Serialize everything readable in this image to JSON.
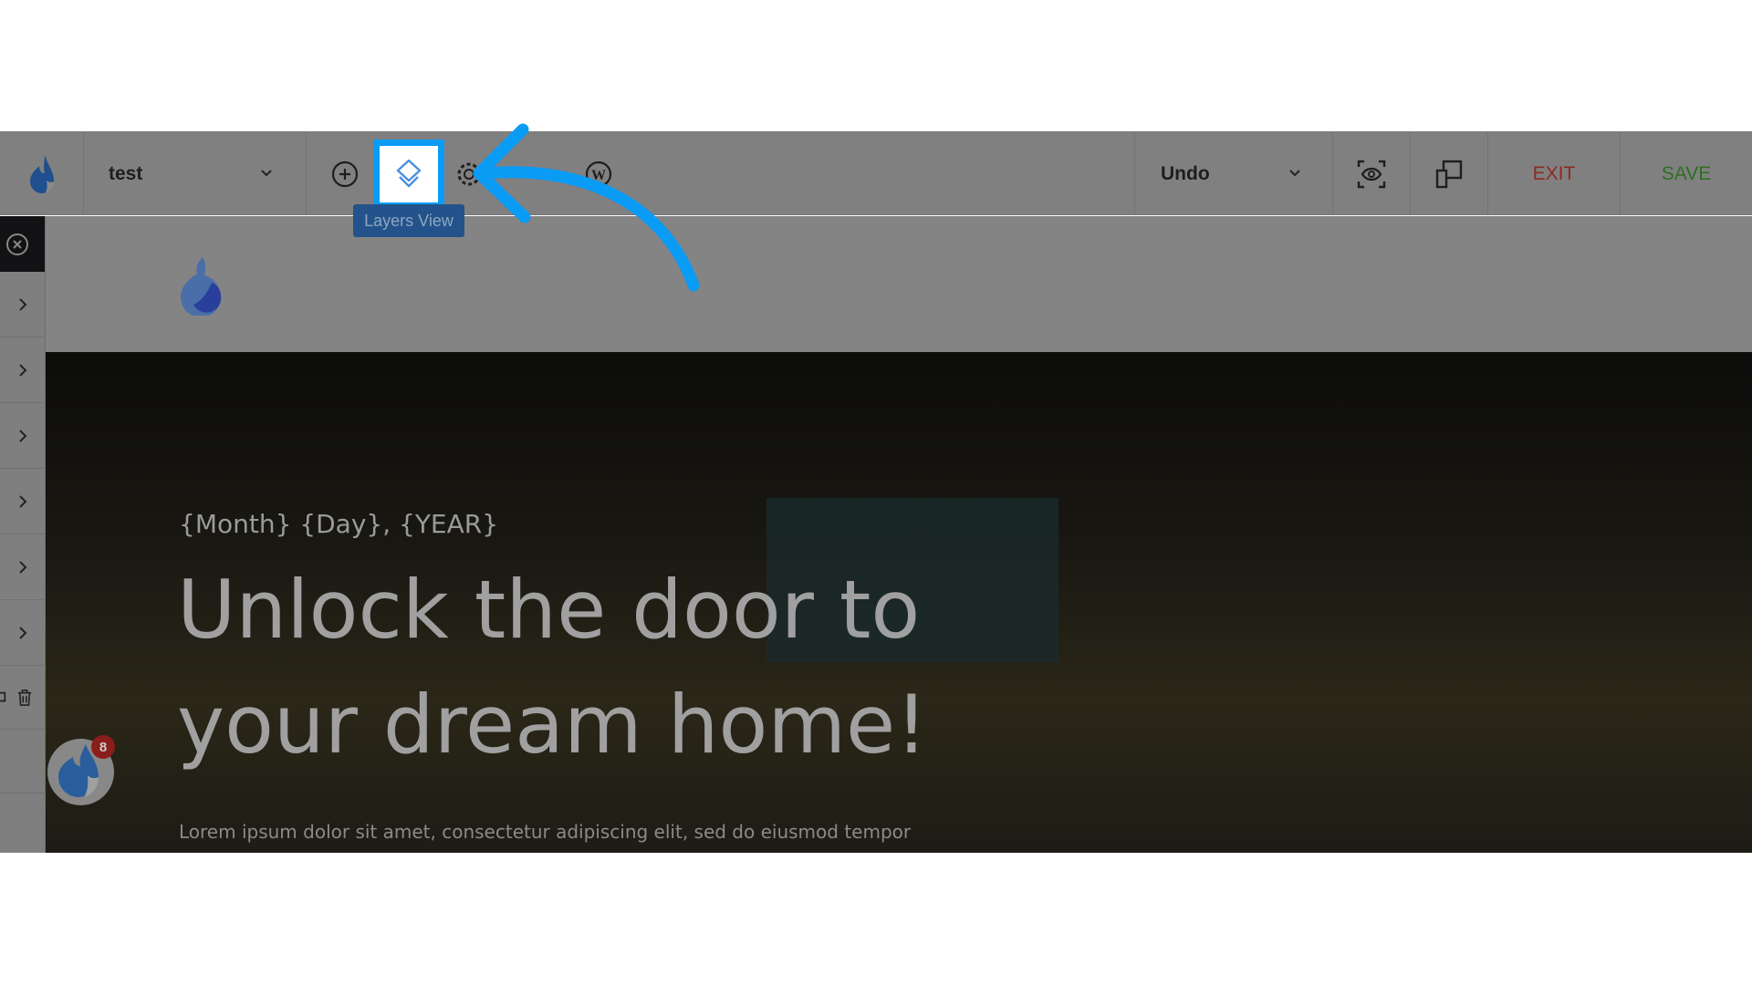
{
  "toolbar": {
    "page_name": "test",
    "undo_label": "Undo",
    "exit_label": "EXIT",
    "save_label": "SAVE",
    "exit_color": "#8b2a22",
    "save_color": "#2f6e22"
  },
  "tooltip": {
    "layers_view": "Layers View"
  },
  "icons": [
    "flame-logo-icon",
    "chevron-down-icon",
    "plus-circle-icon",
    "layers-icon",
    "gear-icon",
    "wordpress-icon",
    "preview-eye-icon",
    "responsive-icon",
    "close-circle-icon",
    "chevron-right-icon",
    "duplicate-icon",
    "trash-icon"
  ],
  "hero": {
    "date": "{Month} {Day}, {YEAR}",
    "headline_line1": "Unlock the door to",
    "headline_line2": "your dream home!",
    "body": "Lorem ipsum dolor sit amet, consectetur adipiscing elit, sed do eiusmod tempor"
  },
  "notification": {
    "count": "8"
  },
  "accent": "#0a9bf5"
}
